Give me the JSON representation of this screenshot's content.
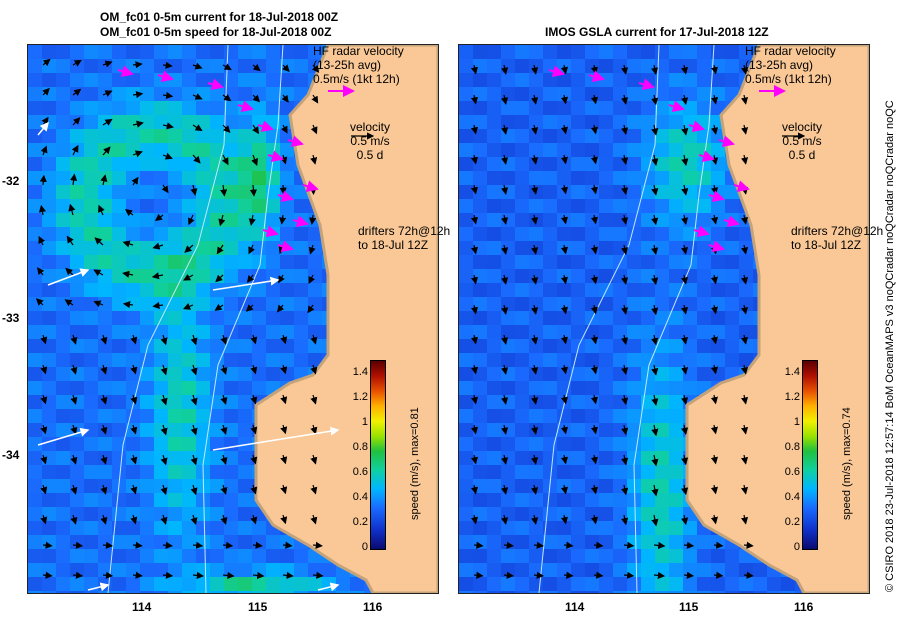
{
  "left_panel": {
    "title_line1": "OM_fc01 0-5m current for 18-Jul-2018 00Z",
    "title_line2": "OM_fc01 0-5m speed for 18-Jul-2018 00Z",
    "colorbar_label": "speed (m/s), max=0.81"
  },
  "right_panel": {
    "title_line1": "IMOS GSLA current for 17-Jul-2018 12Z",
    "colorbar_label": "speed (m/s), max=0.74"
  },
  "annotations": {
    "hf_line1": "HF radar velocity",
    "hf_line2": "(13-25h avg)",
    "hf_line3": "0.5m/s (1kt 12h)",
    "vel_line1": "velocity",
    "vel_line2": "0.5 m/s",
    "vel_line3": "0.5 d",
    "drift_line1": "drifters 72h@12h",
    "drift_line2": "to 18-Jul 12Z"
  },
  "axes": {
    "y_ticks": [
      "-32",
      "-33",
      "-34"
    ],
    "x_ticks": [
      "114",
      "115",
      "116"
    ],
    "colorbar_ticks": [
      "1.4",
      "1.2",
      "1",
      "0.8",
      "0.6",
      "0.4",
      "0.2",
      "0"
    ]
  },
  "credit": "© CSIRO 2018   23-Jul-2018 12:57:14 BoM OceanMAPS v3 noQCradar noQCradar noQCradar noQC",
  "colors": {
    "land": "#f9c896",
    "coast_bank": "#c4a27a",
    "hf_radar": "#ff00ff",
    "velocity_arrow": "#000000",
    "drifter": "#ffffff"
  }
}
